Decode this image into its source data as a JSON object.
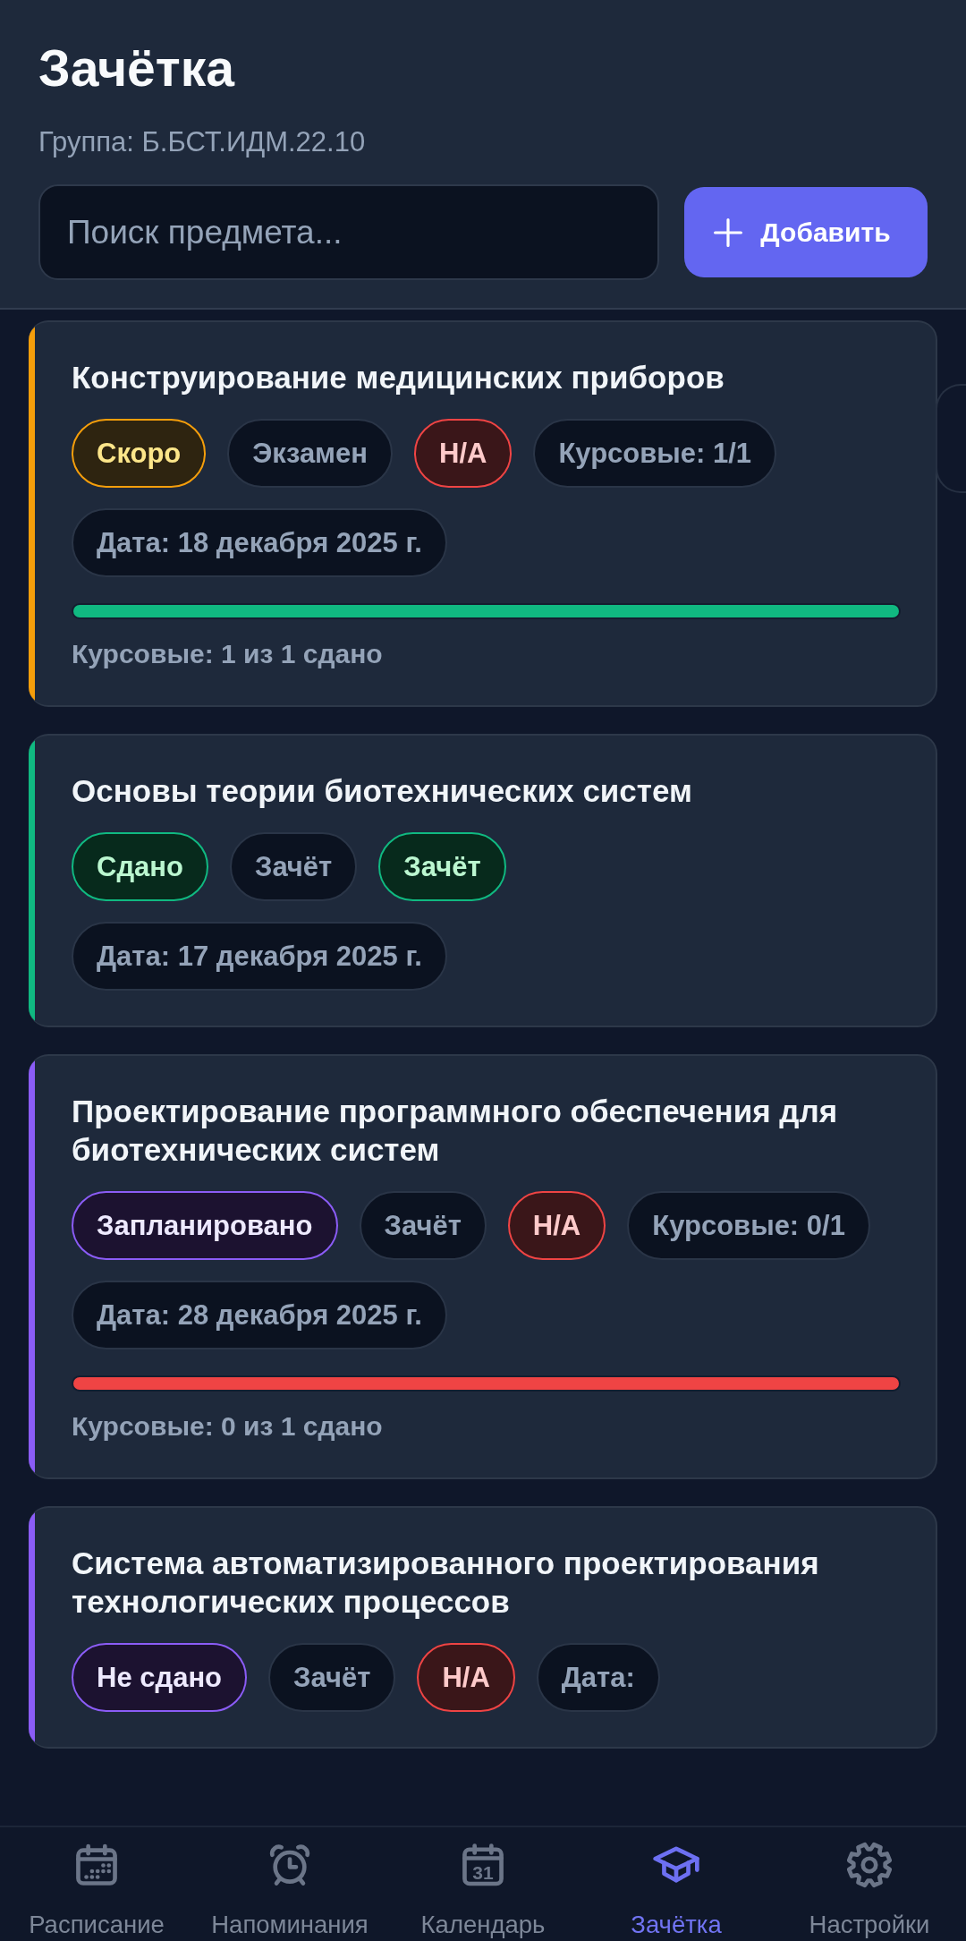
{
  "header": {
    "title": "Зачётка",
    "group": "Группа: Б.БСТ.ИДМ.22.10",
    "search": {
      "placeholder": "Поиск предмета..."
    },
    "add_button": {
      "label": "Добавить"
    }
  },
  "subjects": [
    {
      "title": "Конструирование медицинских приборов",
      "color": "#f59e0b",
      "tags": [
        {
          "label": "Скоро",
          "kind": "warning"
        },
        {
          "label": "Экзамен",
          "kind": "neutral"
        },
        {
          "label": "Н/А",
          "kind": "danger"
        },
        {
          "label": "Курсовые: 1/1",
          "kind": "neutral"
        },
        {
          "label": "Дата: 18 декабря 2025 г.",
          "kind": "neutral"
        }
      ],
      "progress": {
        "level": 1,
        "color": "#10b981"
      },
      "summary": "Курсовые: 1 из 1 сдано"
    },
    {
      "title": "Основы теории биотехнических систем",
      "color": "#10b981",
      "tags": [
        {
          "label": "Сдано",
          "kind": "success"
        },
        {
          "label": "Зачёт",
          "kind": "neutral"
        },
        {
          "label": "Зачёт",
          "kind": "success"
        },
        {
          "label": "Дата: 17 декабря 2025 г.",
          "kind": "neutral"
        }
      ]
    },
    {
      "title": "Проектирование программного обеспечения для биотехнических систем",
      "color": "#8b5cf6",
      "tags": [
        {
          "label": "Запланировано",
          "kind": "planned"
        },
        {
          "label": "Зачёт",
          "kind": "neutral"
        },
        {
          "label": "Н/А",
          "kind": "danger"
        },
        {
          "label": "Курсовые: 0/1",
          "kind": "neutral"
        },
        {
          "label": "Дата: 28 декабря 2025 г.",
          "kind": "neutral"
        }
      ],
      "progress": {
        "level": 1,
        "color": "#ef4444"
      },
      "summary": "Курсовые: 0 из 1 сдано"
    },
    {
      "title": "Система автоматизированного проектирования технологических процессов",
      "color": "#8b5cf6",
      "tags": [
        {
          "label": "Не сдано",
          "kind": "planned"
        },
        {
          "label": "Зачёт",
          "kind": "neutral"
        },
        {
          "label": "Н/А",
          "kind": "danger"
        },
        {
          "label": "Дата:",
          "kind": "neutral"
        }
      ]
    }
  ],
  "nav": [
    {
      "label": "Расписание",
      "selected": false
    },
    {
      "label": "Напоминания",
      "selected": false
    },
    {
      "label": "Календарь",
      "selected": false,
      "icon_text": "31"
    },
    {
      "label": "Зачётка",
      "selected": true
    },
    {
      "label": "Настройки",
      "selected": false
    }
  ]
}
